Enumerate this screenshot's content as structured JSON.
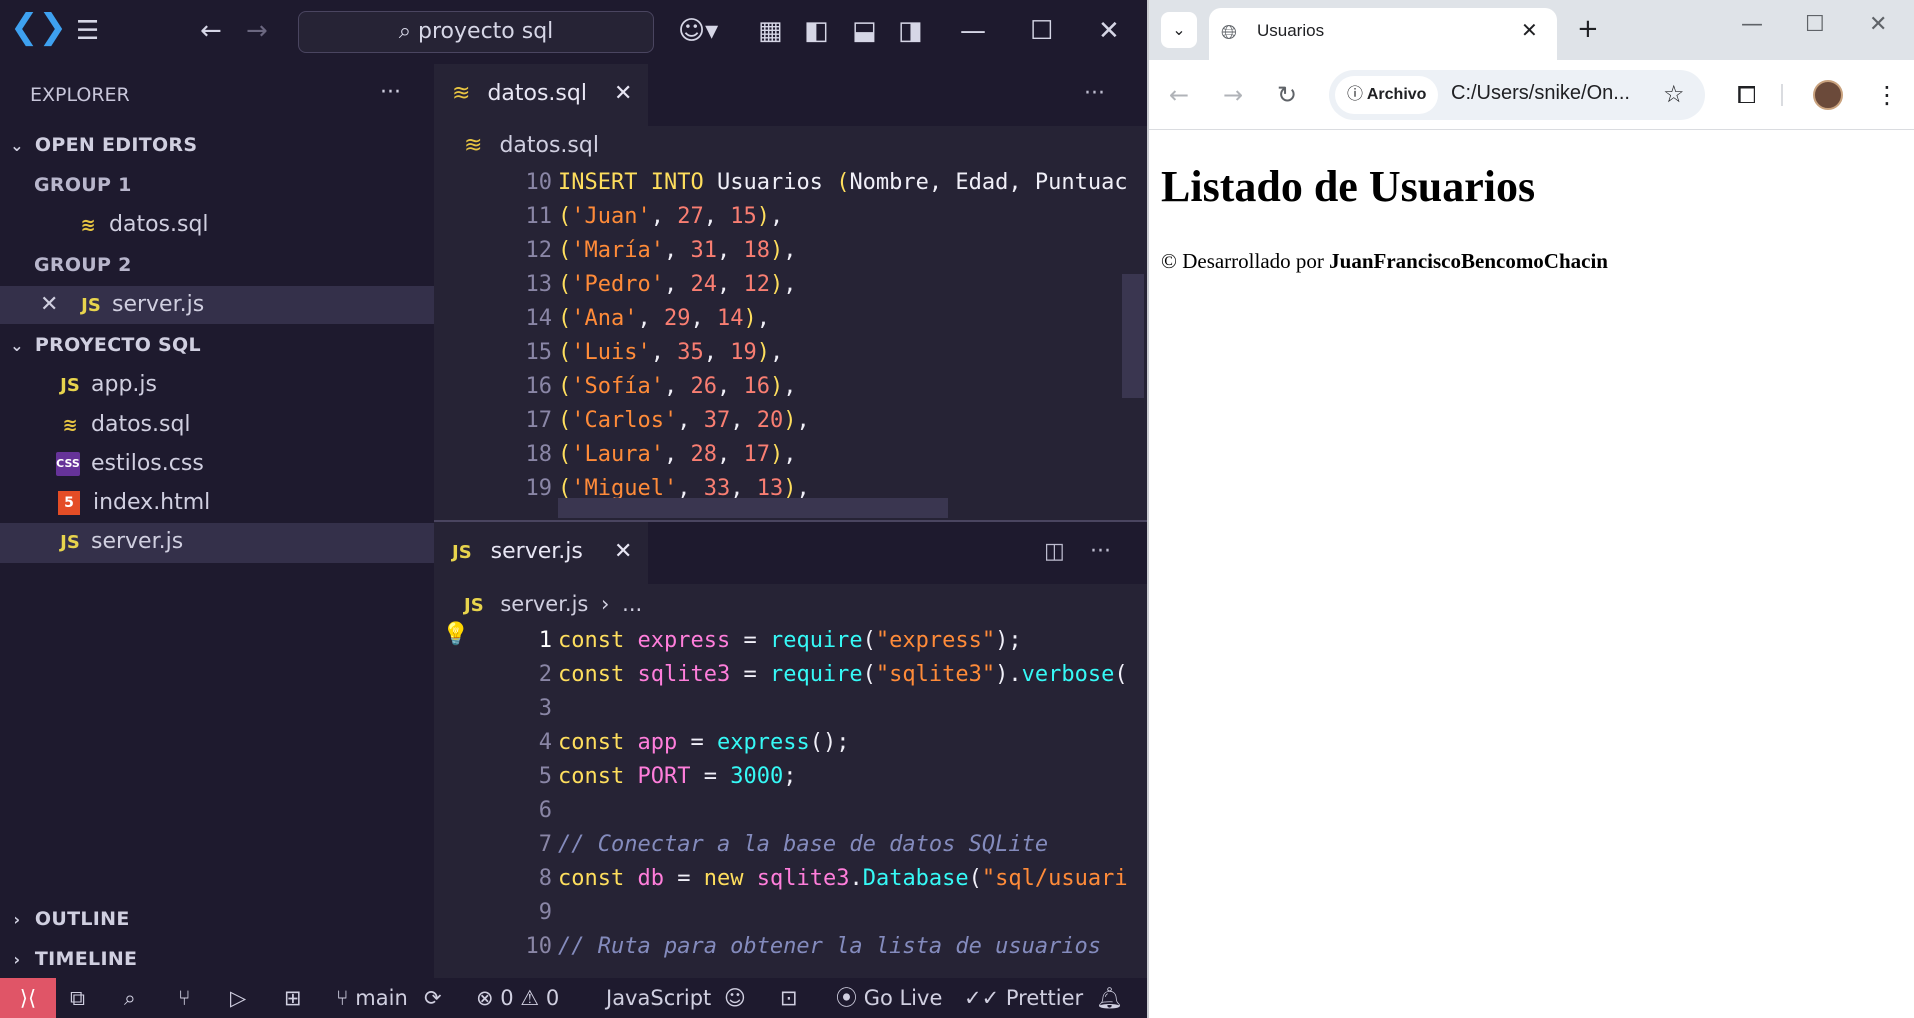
{
  "vscode": {
    "search": "proyecto sql",
    "sidebar": {
      "title": "EXPLORER",
      "more": "···",
      "open_editors": "OPEN EDITORS",
      "group1": "GROUP 1",
      "group1_file": "datos.sql",
      "group2": "GROUP 2",
      "group2_file": "server.js",
      "project": "PROYECTO SQL",
      "files": [
        {
          "name": "app.js",
          "icon": "JS"
        },
        {
          "name": "datos.sql",
          "icon": "db"
        },
        {
          "name": "estilos.css",
          "icon": "CSS"
        },
        {
          "name": "index.html",
          "icon": "5"
        },
        {
          "name": "server.js",
          "icon": "JS"
        }
      ],
      "outline": "OUTLINE",
      "timeline": "TIMELINE"
    },
    "editor1": {
      "tab": "datos.sql",
      "breadcrumb": "datos.sql",
      "lines": [
        {
          "n": "10",
          "html": "<span class='kw'>INSERT</span> <span class='kw'>INTO</span> <span class='txt'>Usuarios</span> <span class='kw'>(</span><span class='txt'>Nombre, Edad, Puntuac</span>"
        },
        {
          "n": "11",
          "html": "<span class='kw'>(</span><span class='str'>'Juan'</span>, <span class='num'>27</span>, <span class='num'>15</span><span class='kw'>)</span>,"
        },
        {
          "n": "12",
          "html": "<span class='kw'>(</span><span class='str'>'María'</span>, <span class='num'>31</span>, <span class='num'>18</span><span class='kw'>)</span>,"
        },
        {
          "n": "13",
          "html": "<span class='kw'>(</span><span class='str'>'Pedro'</span>, <span class='num'>24</span>, <span class='num'>12</span><span class='kw'>)</span>,"
        },
        {
          "n": "14",
          "html": "<span class='kw'>(</span><span class='str'>'Ana'</span>, <span class='num'>29</span>, <span class='num'>14</span><span class='kw'>)</span>,"
        },
        {
          "n": "15",
          "html": "<span class='kw'>(</span><span class='str'>'Luis'</span>, <span class='num'>35</span>, <span class='num'>19</span><span class='kw'>)</span>,"
        },
        {
          "n": "16",
          "html": "<span class='kw'>(</span><span class='str'>'Sofía'</span>, <span class='num'>26</span>, <span class='num'>16</span><span class='kw'>)</span>,"
        },
        {
          "n": "17",
          "html": "<span class='kw'>(</span><span class='str'>'Carlos'</span>, <span class='num'>37</span>, <span class='num'>20</span><span class='kw'>)</span>,"
        },
        {
          "n": "18",
          "html": "<span class='kw'>(</span><span class='str'>'Laura'</span>, <span class='num'>28</span>, <span class='num'>17</span><span class='kw'>)</span>,"
        },
        {
          "n": "19",
          "html": "<span class='kw'>(</span><span class='str'>'Miguel'</span>, <span class='num'>33</span>, <span class='num'>13</span><span class='kw'>)</span>,"
        }
      ]
    },
    "editor2": {
      "tab": "server.js",
      "breadcrumb": "server.js",
      "breadcrumb_more": "...",
      "lines": [
        {
          "n": "1",
          "html": "<span class='kw'>const</span> <span class='var'>express</span> = <span class='fn'>require</span>(<span class='str'>\"express\"</span>);"
        },
        {
          "n": "2",
          "html": "<span class='kw'>const</span> <span class='var'>sqlite3</span> = <span class='fn'>require</span>(<span class='str'>\"sqlite3\"</span>).<span class='fn'>verbose</span>("
        },
        {
          "n": "3",
          "html": ""
        },
        {
          "n": "4",
          "html": "<span class='kw'>const</span> <span class='var'>app</span> = <span class='fn'>express</span>();"
        },
        {
          "n": "5",
          "html": "<span class='kw'>const</span> <span class='var'>PORT</span> = <span class='fn'>3000</span>;"
        },
        {
          "n": "6",
          "html": ""
        },
        {
          "n": "7",
          "html": "<span class='cmt'>// Conectar a la base de datos SQLite</span>"
        },
        {
          "n": "8",
          "html": "<span class='kw'>const</span> <span class='var'>db</span> = <span class='kw'>new</span> <span class='var'>sqlite3</span>.<span class='fn'>Database</span>(<span class='str'>\"sql/usuari</span>"
        },
        {
          "n": "9",
          "html": ""
        },
        {
          "n": "10",
          "html": "<span class='cmt'>// Ruta para obtener la lista de usuarios</span>"
        }
      ]
    },
    "status": {
      "branch": "main",
      "errors": "0",
      "warnings": "0",
      "language": "JavaScript",
      "golive": "Go Live",
      "prettier": "Prettier"
    }
  },
  "browser": {
    "tab_title": "Usuarios",
    "chip": "Archivo",
    "url": "C:/Users/snike/On...",
    "heading": "Listado de Usuarios",
    "footer_prefix": "© Desarrollado por ",
    "footer_author": "JuanFranciscoBencomoChacin"
  }
}
